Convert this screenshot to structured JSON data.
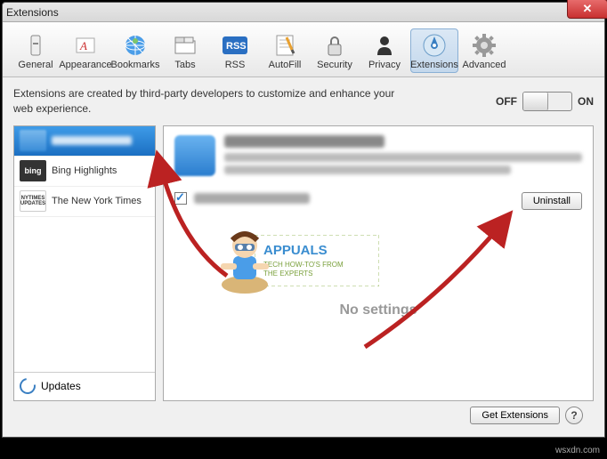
{
  "window": {
    "title": "Extensions",
    "close": "✕"
  },
  "toolbar": {
    "items": [
      {
        "label": "General"
      },
      {
        "label": "Appearance"
      },
      {
        "label": "Bookmarks"
      },
      {
        "label": "Tabs"
      },
      {
        "label": "RSS"
      },
      {
        "label": "AutoFill"
      },
      {
        "label": "Security"
      },
      {
        "label": "Privacy"
      },
      {
        "label": "Extensions"
      },
      {
        "label": "Advanced"
      }
    ]
  },
  "info": {
    "text": "Extensions are created by third-party developers to customize and enhance your web experience.",
    "off": "OFF",
    "on": "ON"
  },
  "sidebar": {
    "items": [
      {
        "label": ""
      },
      {
        "label": "Bing Highlights"
      },
      {
        "label": "The New York Times"
      }
    ],
    "updates": "Updates"
  },
  "detail": {
    "uninstall": "Uninstall",
    "no_settings": "No settings"
  },
  "footer": {
    "get_extensions": "Get Extensions",
    "help": "?"
  },
  "watermark": {
    "brand": "APPUALS",
    "tagline1": "TECH HOW-TO'S FROM",
    "tagline2": "THE EXPERTS"
  },
  "attribution": "wsxdn.com"
}
